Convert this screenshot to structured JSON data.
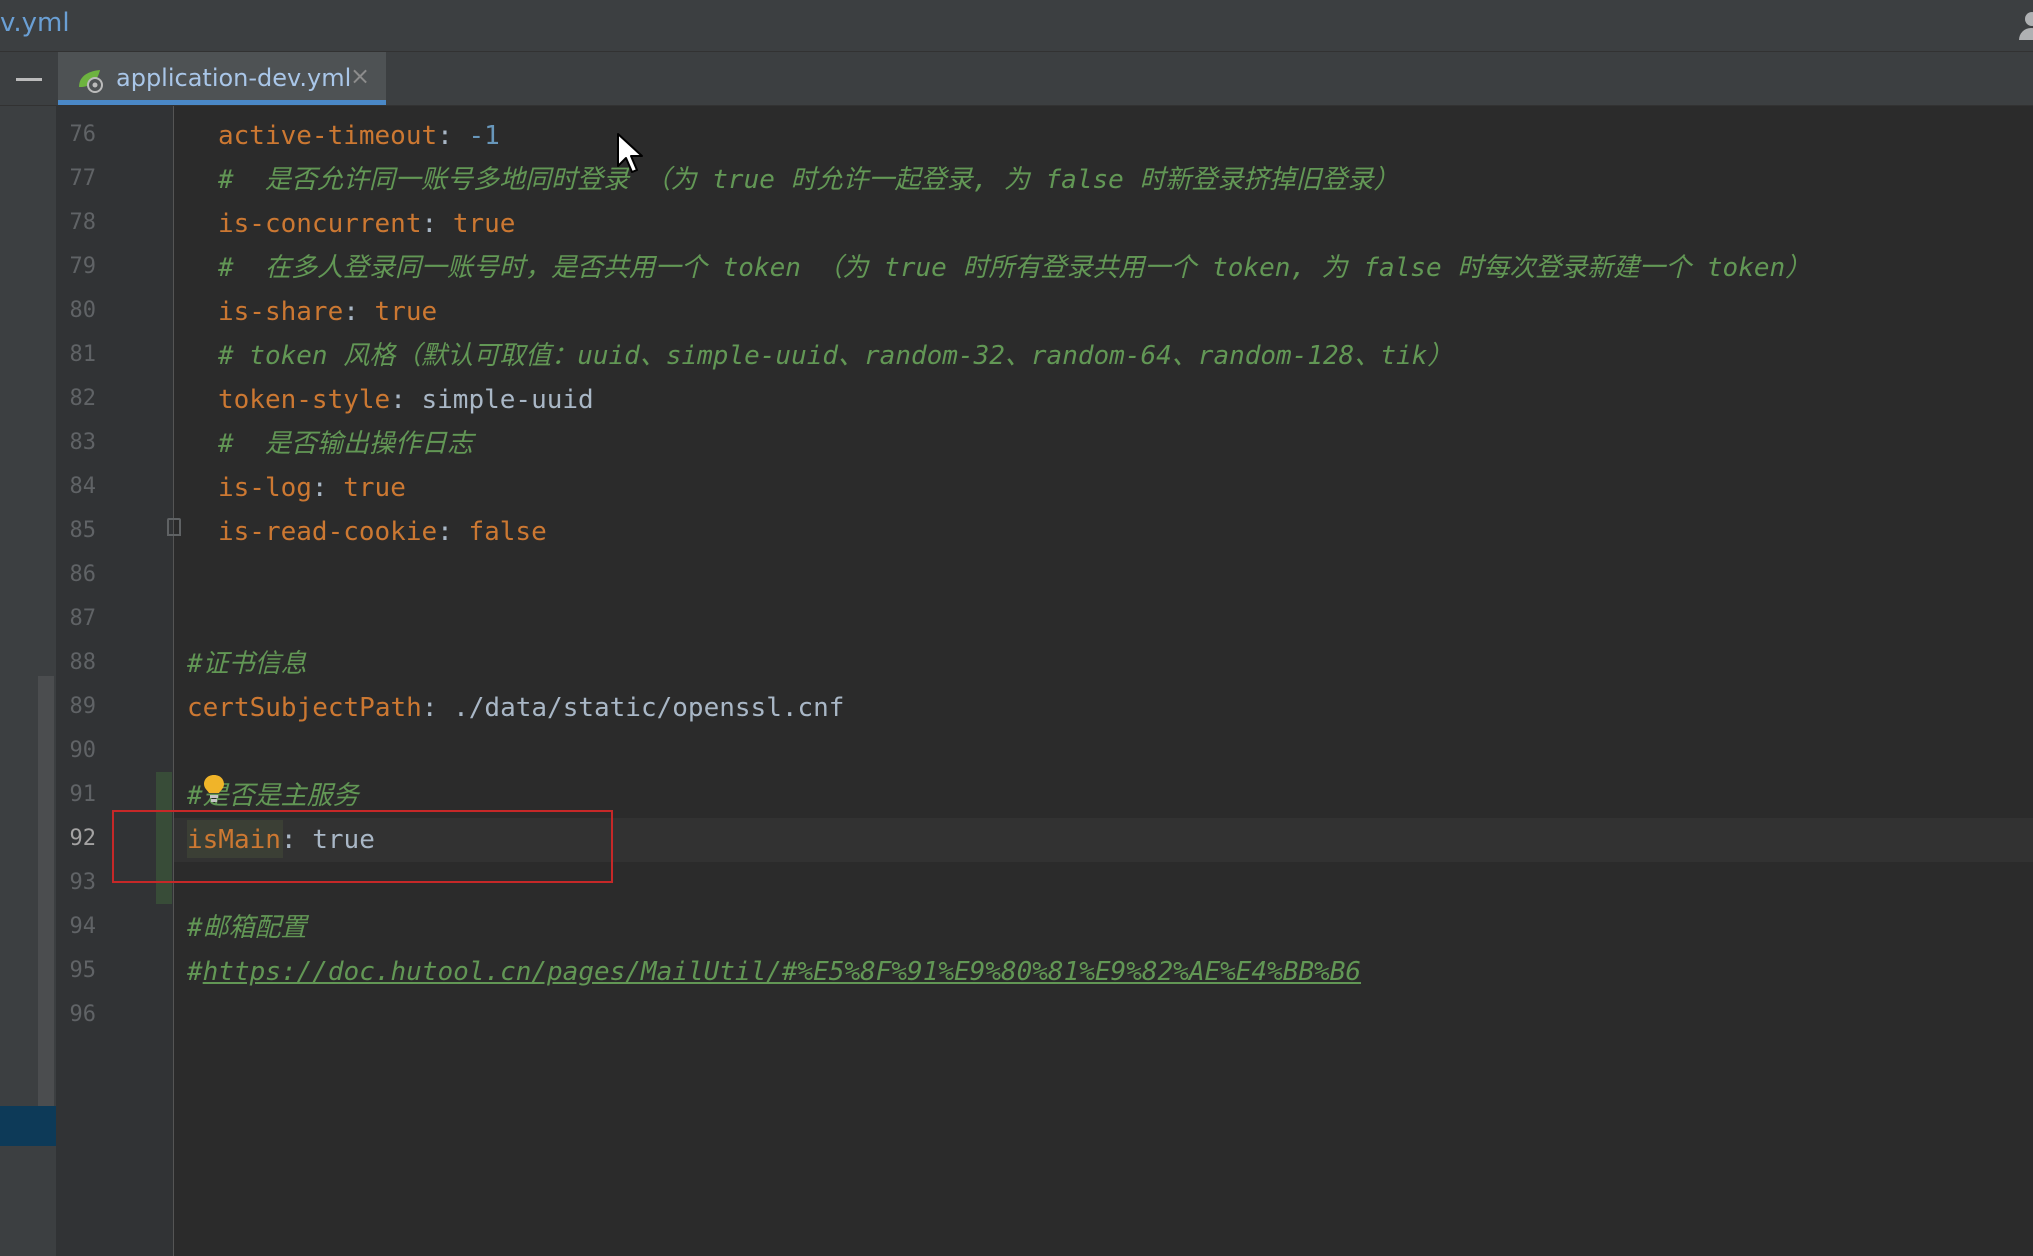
{
  "window": {
    "title": "v.yml"
  },
  "tab": {
    "label": "application-dev.yml",
    "close_glyph": "×",
    "icon": "spring-yaml-icon"
  },
  "editor": {
    "current_line": "92",
    "lines": [
      {
        "num": "76",
        "text": "active-timeout: -1"
      },
      {
        "num": "77",
        "text": "#  是否允许同一账号多地同时登录 （为 true 时允许一起登录, 为 false 时新登录挤掉旧登录）"
      },
      {
        "num": "78",
        "text": "is-concurrent: true"
      },
      {
        "num": "79",
        "text": "#  在多人登录同一账号时，是否共用一个 token （为 true 时所有登录共用一个 token, 为 false 时每次登录新建一个 token）"
      },
      {
        "num": "80",
        "text": "is-share: true"
      },
      {
        "num": "81",
        "text": "# token 风格（默认可取值：uuid、simple-uuid、random-32、random-64、random-128、tik）"
      },
      {
        "num": "82",
        "text": "token-style: simple-uuid"
      },
      {
        "num": "83",
        "text": "#  是否输出操作日志"
      },
      {
        "num": "84",
        "text": "is-log: true"
      },
      {
        "num": "85",
        "text": "is-read-cookie: false"
      },
      {
        "num": "86",
        "text": ""
      },
      {
        "num": "87",
        "text": ""
      },
      {
        "num": "88",
        "text": "#证书信息"
      },
      {
        "num": "89",
        "text": "certSubjectPath: ./data/static/openssl.cnf"
      },
      {
        "num": "90",
        "text": ""
      },
      {
        "num": "91",
        "text": "#是否是主服务"
      },
      {
        "num": "92",
        "text": "isMain: true"
      },
      {
        "num": "93",
        "text": ""
      },
      {
        "num": "94",
        "text": "#邮箱配置"
      },
      {
        "num": "95",
        "text": "#https://doc.hutool.cn/pages/MailUtil/#%E5%8F%91%E9%80%81%E9%82%AE%E4%BB%B6"
      },
      {
        "num": "96",
        "text": ""
      }
    ],
    "tokens": {
      "l76_key": "active-timeout",
      "l76_val": "-1",
      "l77_c": "#  是否允许同一账号多地同时登录 （为 true 时允许一起登录, 为 false 时新登录挤掉旧登录）",
      "l78_key": "is-concurrent",
      "l78_val": "true",
      "l79_c": "#  在多人登录同一账号时，是否共用一个 token （为 true 时所有登录共用一个 token, 为 false 时每次登录新建一个 token）",
      "l80_key": "is-share",
      "l80_val": "true",
      "l81_c": "# token 风格（默认可取值：uuid、simple-uuid、random-32、random-64、random-128、tik）",
      "l82_key": "token-style",
      "l82_val": "simple-uuid",
      "l83_c": "#  是否输出操作日志",
      "l84_key": "is-log",
      "l84_val": "true",
      "l85_key": "is-read-cookie",
      "l85_val": "false",
      "l88_c": "#证书信息",
      "l89_key": "certSubjectPath",
      "l89_val": "./data/static/openssl.cnf",
      "l91_c": "#是否是主服务",
      "l92_key": "isMain",
      "l92_val": "true",
      "l94_c": "#邮箱配置",
      "l95_hash": "#",
      "l95_link": "https://doc.hutool.cn/pages/MailUtil/#%E5%8F%91%E9%80%81%E9%82%AE%E4%BB%B6",
      "colon": ": "
    }
  },
  "colors": {
    "background": "#2b2b2b",
    "key": "#cc7832",
    "comment": "#629755",
    "number": "#6897bb",
    "text": "#a9b7c6",
    "tab_underline": "#4a88c7",
    "highlight_box": "#c62828"
  }
}
